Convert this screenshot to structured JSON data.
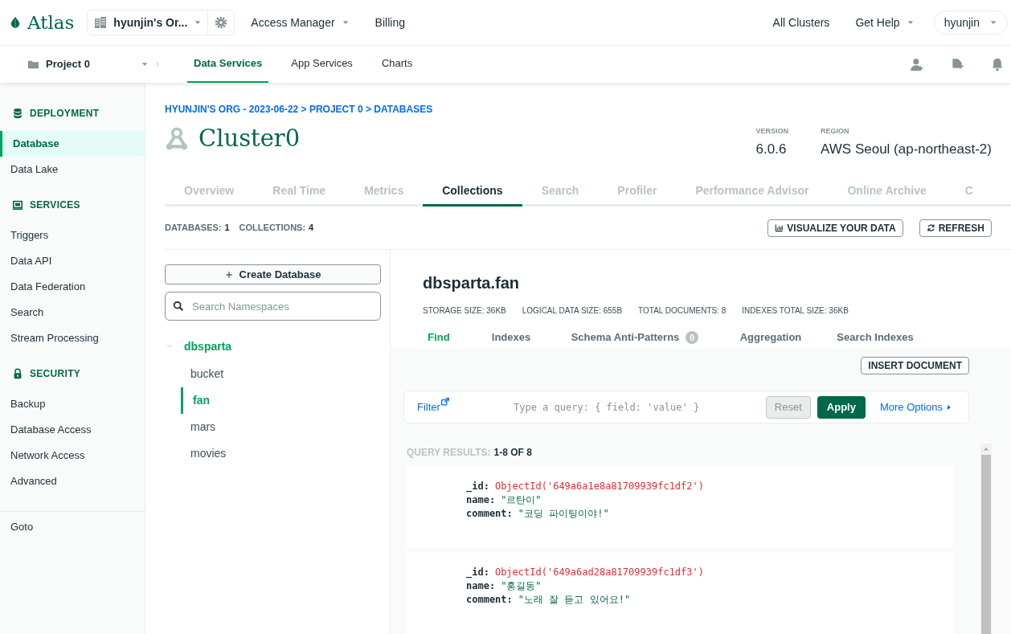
{
  "top_bar": {
    "logo": "Atlas",
    "org_selector": "hyunjin's Or...",
    "nav": [
      {
        "label": "Access Manager",
        "dropdown": true
      },
      {
        "label": "Billing",
        "dropdown": false
      }
    ],
    "right": [
      {
        "label": "All Clusters",
        "dropdown": false
      },
      {
        "label": "Get Help",
        "dropdown": true
      }
    ],
    "user": "hyunjin"
  },
  "project_bar": {
    "project": "Project 0",
    "tabs": [
      {
        "label": "Data Services",
        "selected": true
      },
      {
        "label": "App Services",
        "selected": false
      },
      {
        "label": "Charts",
        "selected": false
      }
    ]
  },
  "sidebar": {
    "sections": [
      {
        "title": "DEPLOYMENT",
        "kind": "database",
        "items": [
          {
            "label": "Database",
            "selected": true
          },
          {
            "label": "Data Lake",
            "selected": false
          }
        ]
      },
      {
        "title": "SERVICES",
        "kind": "services",
        "items": [
          {
            "label": "Triggers",
            "selected": false
          },
          {
            "label": "Data API",
            "selected": false
          },
          {
            "label": "Data Federation",
            "selected": false
          },
          {
            "label": "Search",
            "selected": false
          },
          {
            "label": "Stream Processing",
            "selected": false
          }
        ]
      },
      {
        "title": "SECURITY",
        "kind": "security",
        "items": [
          {
            "label": "Backup",
            "selected": false
          },
          {
            "label": "Database Access",
            "selected": false
          },
          {
            "label": "Network Access",
            "selected": false
          },
          {
            "label": "Advanced",
            "selected": false
          }
        ]
      }
    ],
    "footer": "Goto"
  },
  "cluster": {
    "breadcrumb": "HYUNJIN'S ORG - 2023-06-22 > PROJECT 0 > DATABASES",
    "name": "Cluster0",
    "info": [
      {
        "label": "VERSION",
        "value": "6.0.6"
      },
      {
        "label": "REGION",
        "value": "AWS Seoul (ap-northeast-2)"
      }
    ],
    "tabs": [
      {
        "label": "Overview",
        "selected": false
      },
      {
        "label": "Real Time",
        "selected": false
      },
      {
        "label": "Metrics",
        "selected": false
      },
      {
        "label": "Collections",
        "selected": true
      },
      {
        "label": "Search",
        "selected": false
      },
      {
        "label": "Profiler",
        "selected": false
      },
      {
        "label": "Performance Advisor",
        "selected": false
      },
      {
        "label": "Online Archive",
        "selected": false
      },
      {
        "label": "C",
        "selected": false
      }
    ]
  },
  "counts": [
    {
      "label": "DATABASES:",
      "value": "1"
    },
    {
      "label": "COLLECTIONS:",
      "value": "4"
    }
  ],
  "actions": [
    {
      "label": "VISUALIZE YOUR DATA",
      "kind": "chart"
    },
    {
      "label": "REFRESH",
      "kind": "refresh"
    }
  ],
  "namespaces": {
    "create_button": "Create Database",
    "search": {
      "placeholder": "Search Namespaces"
    },
    "tree": [
      {
        "label": "dbsparta",
        "expanded": true,
        "children": [
          {
            "label": "bucket",
            "selected": false
          },
          {
            "label": "fan",
            "selected": true
          },
          {
            "label": "mars",
            "selected": false
          },
          {
            "label": "movies",
            "selected": false
          }
        ]
      }
    ]
  },
  "collection": {
    "title": "dbsparta.fan",
    "stats": [
      {
        "label": "STORAGE SIZE:",
        "value": "36KB"
      },
      {
        "label": "LOGICAL DATA SIZE:",
        "value": "655B"
      },
      {
        "label": "TOTAL DOCUMENTS:",
        "value": "8"
      },
      {
        "label": "INDEXES TOTAL SIZE:",
        "value": "36KB"
      }
    ],
    "tabs": [
      {
        "label": "Find",
        "selected": true
      },
      {
        "label": "Indexes",
        "selected": false
      },
      {
        "label": "Schema Anti-Patterns",
        "selected": false,
        "badge": "0"
      },
      {
        "label": "Aggregation",
        "selected": false
      },
      {
        "label": "Search Indexes",
        "selected": false
      }
    ],
    "insert_button": "INSERT DOCUMENT",
    "query": {
      "filter_link": "Filter",
      "placeholder": "Type a query: { field: 'value' }",
      "reset": "Reset",
      "apply": "Apply",
      "more": "More Options"
    },
    "results": {
      "label": "QUERY RESULTS:",
      "value": "1-8 OF 8"
    },
    "documents": [
      {
        "fields": [
          {
            "key": "_id:",
            "value": "ObjectId('649a6a1e8a81709939fc1df2')",
            "kind": "objectid"
          },
          {
            "key": "name:",
            "value": "\"르탄이\"",
            "kind": "string"
          },
          {
            "key": "comment:",
            "value": "\"코딩 파이팅이야!\"",
            "kind": "string"
          }
        ]
      },
      {
        "fields": [
          {
            "key": "_id:",
            "value": "ObjectId('649a6ad28a81709939fc1df3')",
            "kind": "objectid"
          },
          {
            "key": "name:",
            "value": "\"홍길동\"",
            "kind": "string"
          },
          {
            "key": "comment:",
            "value": "\"노래 잘 듣고 있어요!\"",
            "kind": "string"
          }
        ]
      }
    ]
  }
}
